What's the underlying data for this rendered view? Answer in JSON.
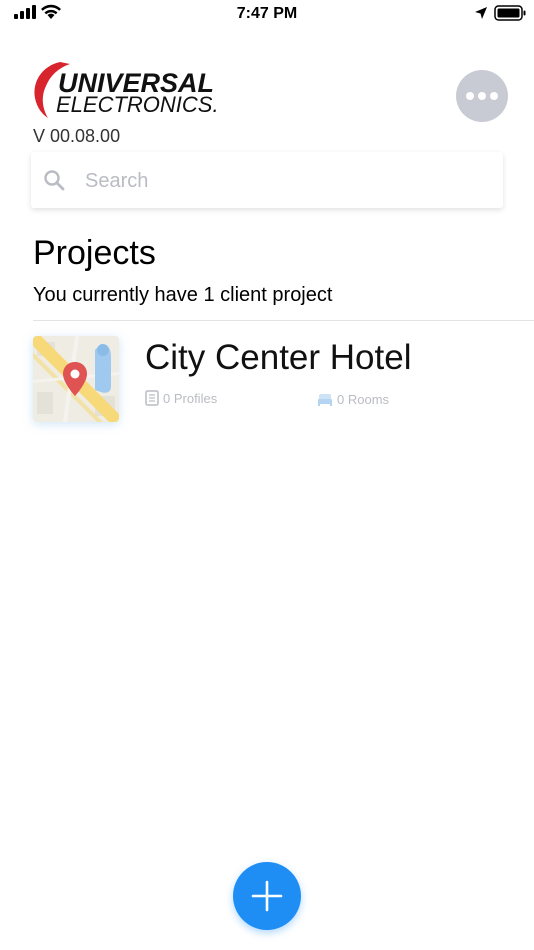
{
  "status_bar": {
    "time": "7:47 PM",
    "icons": [
      "signal-icon",
      "wifi-icon",
      "location-icon",
      "battery-icon"
    ]
  },
  "header": {
    "logo_line1": "UNIVERSAL",
    "logo_line2": "ELECTRONICS.",
    "version": "V 00.08.00",
    "more_icon": "ellipsis-icon"
  },
  "search": {
    "placeholder": "Search",
    "value": ""
  },
  "projects": {
    "title": "Projects",
    "subtitle": "You currently have 1 client project",
    "items": [
      {
        "name": "City Center Hotel",
        "profiles": "0 Profiles",
        "rooms": "0 Rooms"
      }
    ]
  },
  "colors": {
    "accent": "#1e8ef5",
    "more_button": "#c8cbd3",
    "logo_red": "#d8242c",
    "meta_text": "#b9bcc2"
  }
}
